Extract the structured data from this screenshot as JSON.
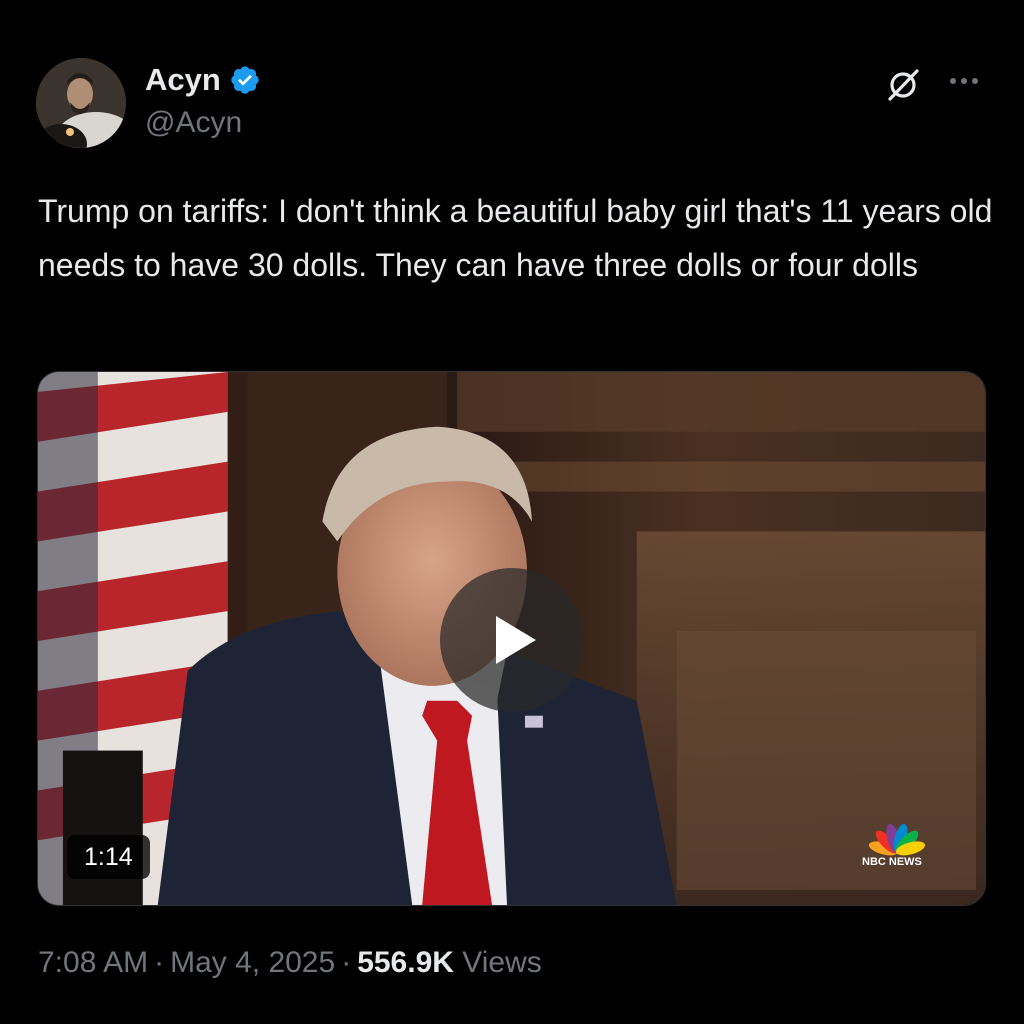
{
  "author": {
    "display_name": "Acyn",
    "handle": "@Acyn",
    "verified": true
  },
  "icons": {
    "verified": "verified-badge-icon",
    "grok": "grok-icon",
    "more": "more-options-icon",
    "play": "play-icon"
  },
  "tweet": {
    "text": "Trump on tariffs: I don't think a beautiful baby girl that's 11 years old needs to have 30 dolls. They can have three dolls or four dolls"
  },
  "media": {
    "type": "video",
    "duration": "1:14",
    "watermark": "NBC NEWS"
  },
  "meta": {
    "time": "7:08 AM",
    "date": "May 4, 2025",
    "separator": "·",
    "views_count": "556.9K",
    "views_label": "Views"
  },
  "colors": {
    "background": "#000000",
    "text_primary": "#e7e9ea",
    "text_secondary": "#71767b",
    "verified_blue": "#1d9bf0"
  }
}
